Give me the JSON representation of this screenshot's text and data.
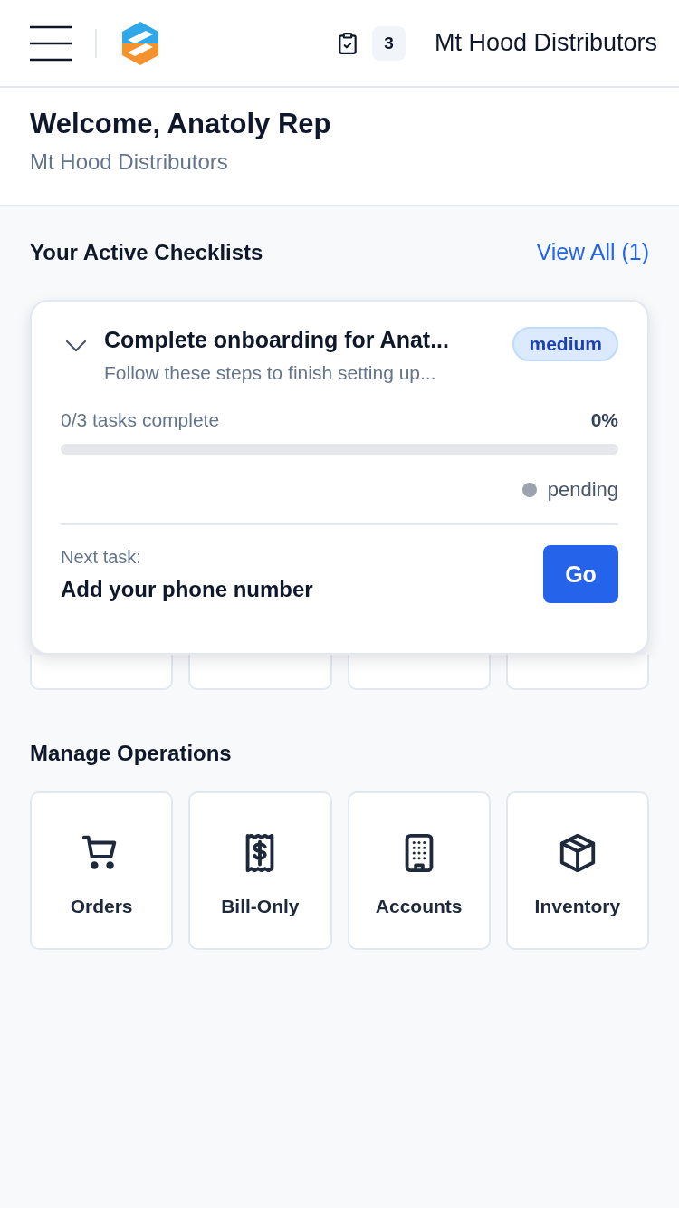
{
  "header": {
    "task_count": "3",
    "company": "Mt Hood Distributors"
  },
  "welcome": {
    "title": "Welcome, Anatoly Rep",
    "subtitle": "Mt Hood Distributors"
  },
  "checklists": {
    "heading": "Your Active Checklists",
    "view_all": "View All (1)",
    "card": {
      "expanded": true,
      "title": "Complete onboarding for Anat...",
      "priority": "medium",
      "description": "Follow these steps to finish setting up...",
      "progress_text": "0/3 tasks complete",
      "percent": "0%",
      "level": 0,
      "status": "pending",
      "next_label": "Next task:",
      "next_task": "Add your phone number",
      "go": "Go"
    }
  },
  "hidden_tiles": [
    {
      "kind": "tile"
    },
    {
      "kind": "tile"
    },
    {
      "kind": "tile"
    },
    {
      "kind": "tile"
    }
  ],
  "operations": {
    "heading": "Manage Operations",
    "tiles": [
      {
        "kind": "cart",
        "label": "Orders"
      },
      {
        "kind": "receipt",
        "label": "Bill-Only"
      },
      {
        "kind": "building",
        "label": "Accounts"
      },
      {
        "kind": "box",
        "label": "Inventory"
      }
    ]
  }
}
